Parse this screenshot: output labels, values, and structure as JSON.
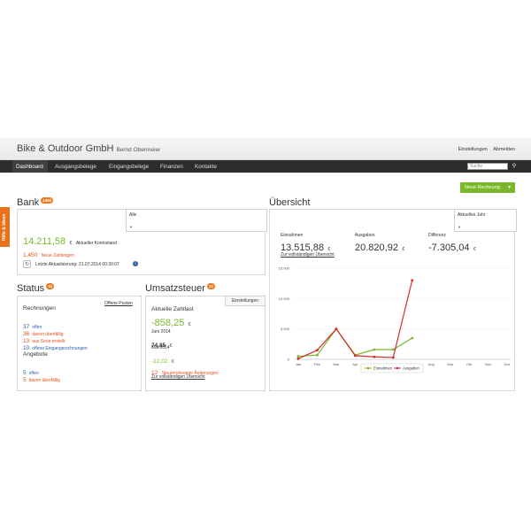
{
  "header": {
    "company": "Bike & Outdoor GmbH",
    "owner": "Bernd Obermeier",
    "settings": "Einstellungen",
    "logout": "Abmelden"
  },
  "nav": {
    "items": [
      "Dashboard",
      "Ausgangsbelege",
      "Eingangsbelege",
      "Finanzen",
      "Kontakte"
    ],
    "search_placeholder": "Suche"
  },
  "new_invoice_button": "Neue Rechnung",
  "side_tab": "Hilfe & Ideen",
  "bank": {
    "title": "Bank",
    "badge": "1450",
    "filter": "Alle",
    "balance": "14.211,58",
    "balance_currency": "€",
    "balance_label": "Aktueller Kontostand",
    "new_count": "1.450",
    "new_label": "Neue Zahlungen",
    "last_update": "Letzte Aktualisierung: 31.07.2014 00:30:07"
  },
  "status": {
    "title": "Status",
    "badge": "41",
    "invoices_heading": "Rechnungen",
    "open_items_link": "Offene Posten",
    "rows": [
      {
        "count": "37",
        "label": "offen",
        "color": "blue"
      },
      {
        "count": "36",
        "label": "davon überfällig",
        "color": "red"
      },
      {
        "count": "13",
        "label": "aus Serie erstellt",
        "color": "red"
      },
      {
        "count": "10",
        "label": "offene Eingangsrechnungen",
        "color": "blue"
      }
    ],
    "offers_heading": "Angebote",
    "offer_rows": [
      {
        "count": "5",
        "label": "offen",
        "color": "blue"
      },
      {
        "count": "5",
        "label": "davon überfällig",
        "color": "red"
      }
    ]
  },
  "tax": {
    "title": "Umsatzsteuer",
    "badge": "12",
    "settings_tab": "Einstellungen",
    "current_label": "Aktuelle Zahllast",
    "current_value": "-858,25",
    "currency": "€",
    "june_label": "Juni 2014",
    "june_value": "74,85",
    "may_label": "Mai 2014",
    "may_value": "-12,02",
    "changes_count": "12",
    "changes_label": "Steuerrelevante Änderungen",
    "full_view": "Zur vollständigen Übersicht"
  },
  "overview": {
    "title": "Übersicht",
    "filter": "Aktuelles Jahr",
    "income_label": "Einnahmen",
    "income_value": "13.515,88",
    "expense_label": "Ausgaben",
    "expense_value": "20.820,92",
    "diff_label": "Differenz",
    "diff_value": "-7.305,04",
    "currency": "€",
    "full_view": "Zur vollständigen Übersicht"
  },
  "chart_data": {
    "type": "line",
    "categories": [
      "Jan",
      "Feb",
      "Mar",
      "Apr",
      "Mai",
      "Jun",
      "Jul",
      "Aug",
      "Sep",
      "Okt",
      "Nov",
      "Dez"
    ],
    "y_ticks": [
      "0",
      "5.000",
      "10.000",
      "15.000"
    ],
    "ylim": [
      0,
      15000
    ],
    "series": [
      {
        "name": "Einnahmen",
        "color": "#7ab829",
        "values": [
          500,
          700,
          5000,
          700,
          1600,
          1600,
          3500
        ]
      },
      {
        "name": "Ausgaben",
        "color": "#d62b2b",
        "values": [
          100,
          1500,
          5000,
          600,
          400,
          300,
          13000
        ]
      }
    ],
    "legend_position": "bottom-center"
  }
}
